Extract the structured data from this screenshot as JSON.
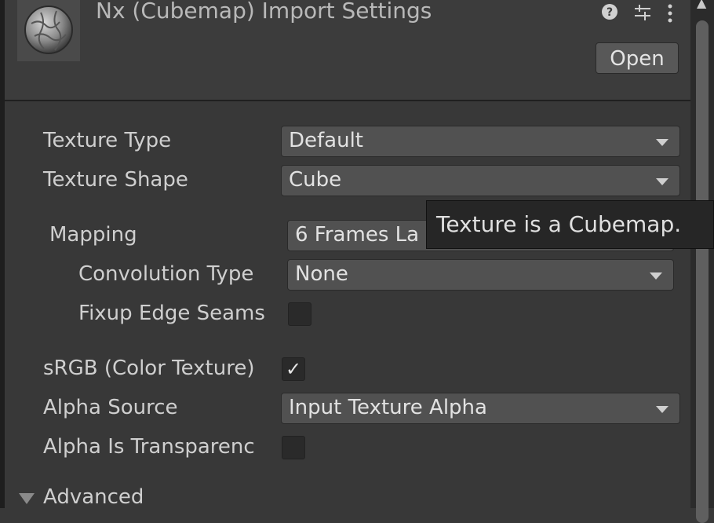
{
  "header": {
    "title": "Nx (Cubemap) Import Settings",
    "help_icon": "help-icon",
    "preset_icon": "presets-sliders-icon",
    "menu_icon": "kebab-menu-icon",
    "open_label": "Open"
  },
  "fields": {
    "texture_type": {
      "label": "Texture Type",
      "value": "Default"
    },
    "texture_shape": {
      "label": "Texture Shape",
      "value": "Cube"
    },
    "mapping": {
      "label": "Mapping",
      "value": "6 Frames La"
    },
    "convolution_type": {
      "label": "Convolution Type",
      "value": "None"
    },
    "fixup_edge_seams": {
      "label": "Fixup Edge Seams",
      "checked": false
    },
    "srgb": {
      "label": "sRGB (Color Texture)",
      "checked": true
    },
    "alpha_source": {
      "label": "Alpha Source",
      "value": "Input Texture Alpha"
    },
    "alpha_is_transparency": {
      "label": "Alpha Is Transparenc",
      "checked": false
    }
  },
  "advanced": {
    "label": "Advanced",
    "expanded": true
  },
  "tooltip": {
    "text": "Texture is a Cubemap."
  },
  "colors": {
    "background": "#383838",
    "header": "#3c3c3c",
    "field": "#515151",
    "tooltip": "#262626"
  }
}
